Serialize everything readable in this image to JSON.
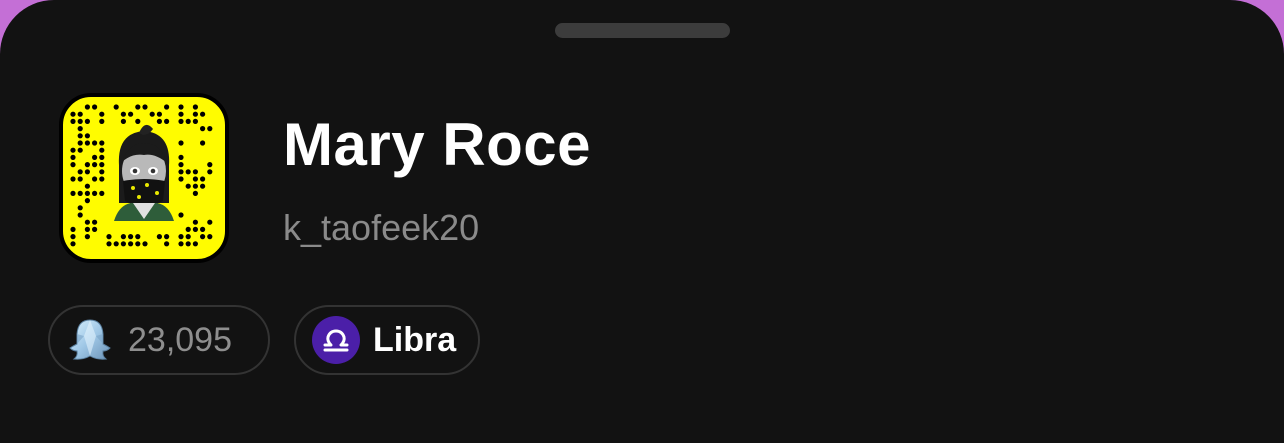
{
  "profile": {
    "display_name": "Mary Roce",
    "username": "k_taofeek20",
    "snapcode_icon": "snapcode-bitmoji-icon"
  },
  "badges": {
    "snap_score": {
      "value": "23,095",
      "icon": "snap-score-ghost-icon"
    },
    "zodiac": {
      "label": "Libra",
      "icon": "libra-zodiac-icon"
    }
  },
  "colors": {
    "background": "#121212",
    "snapcode_yellow": "#FFFC00",
    "zodiac_purple": "#4b1fa8",
    "accent_border": "#c46fd6"
  }
}
